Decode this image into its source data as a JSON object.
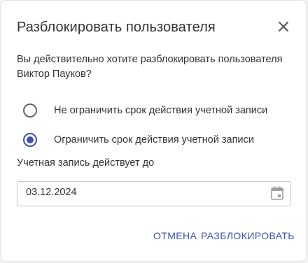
{
  "dialog": {
    "title": "Разблокировать пользователя",
    "message": "Вы действительно хотите разблокировать пользователя Виктор Пауков?"
  },
  "options": [
    {
      "label": "Не ограничить срок действия учетной записи",
      "selected": false
    },
    {
      "label": "Ограничить срок действия учетной записи",
      "selected": true
    }
  ],
  "validity": {
    "label": "Учетная запись действует до",
    "date": "03.12.2024"
  },
  "actions": {
    "cancel": "ОТМЕНА",
    "unlock": "РАЗБЛОКИРОВАТЬ"
  },
  "colors": {
    "accent": "#3f51b5",
    "text": "#333333"
  },
  "icons": {
    "close": "close-icon",
    "calendar": "calendar-icon"
  }
}
